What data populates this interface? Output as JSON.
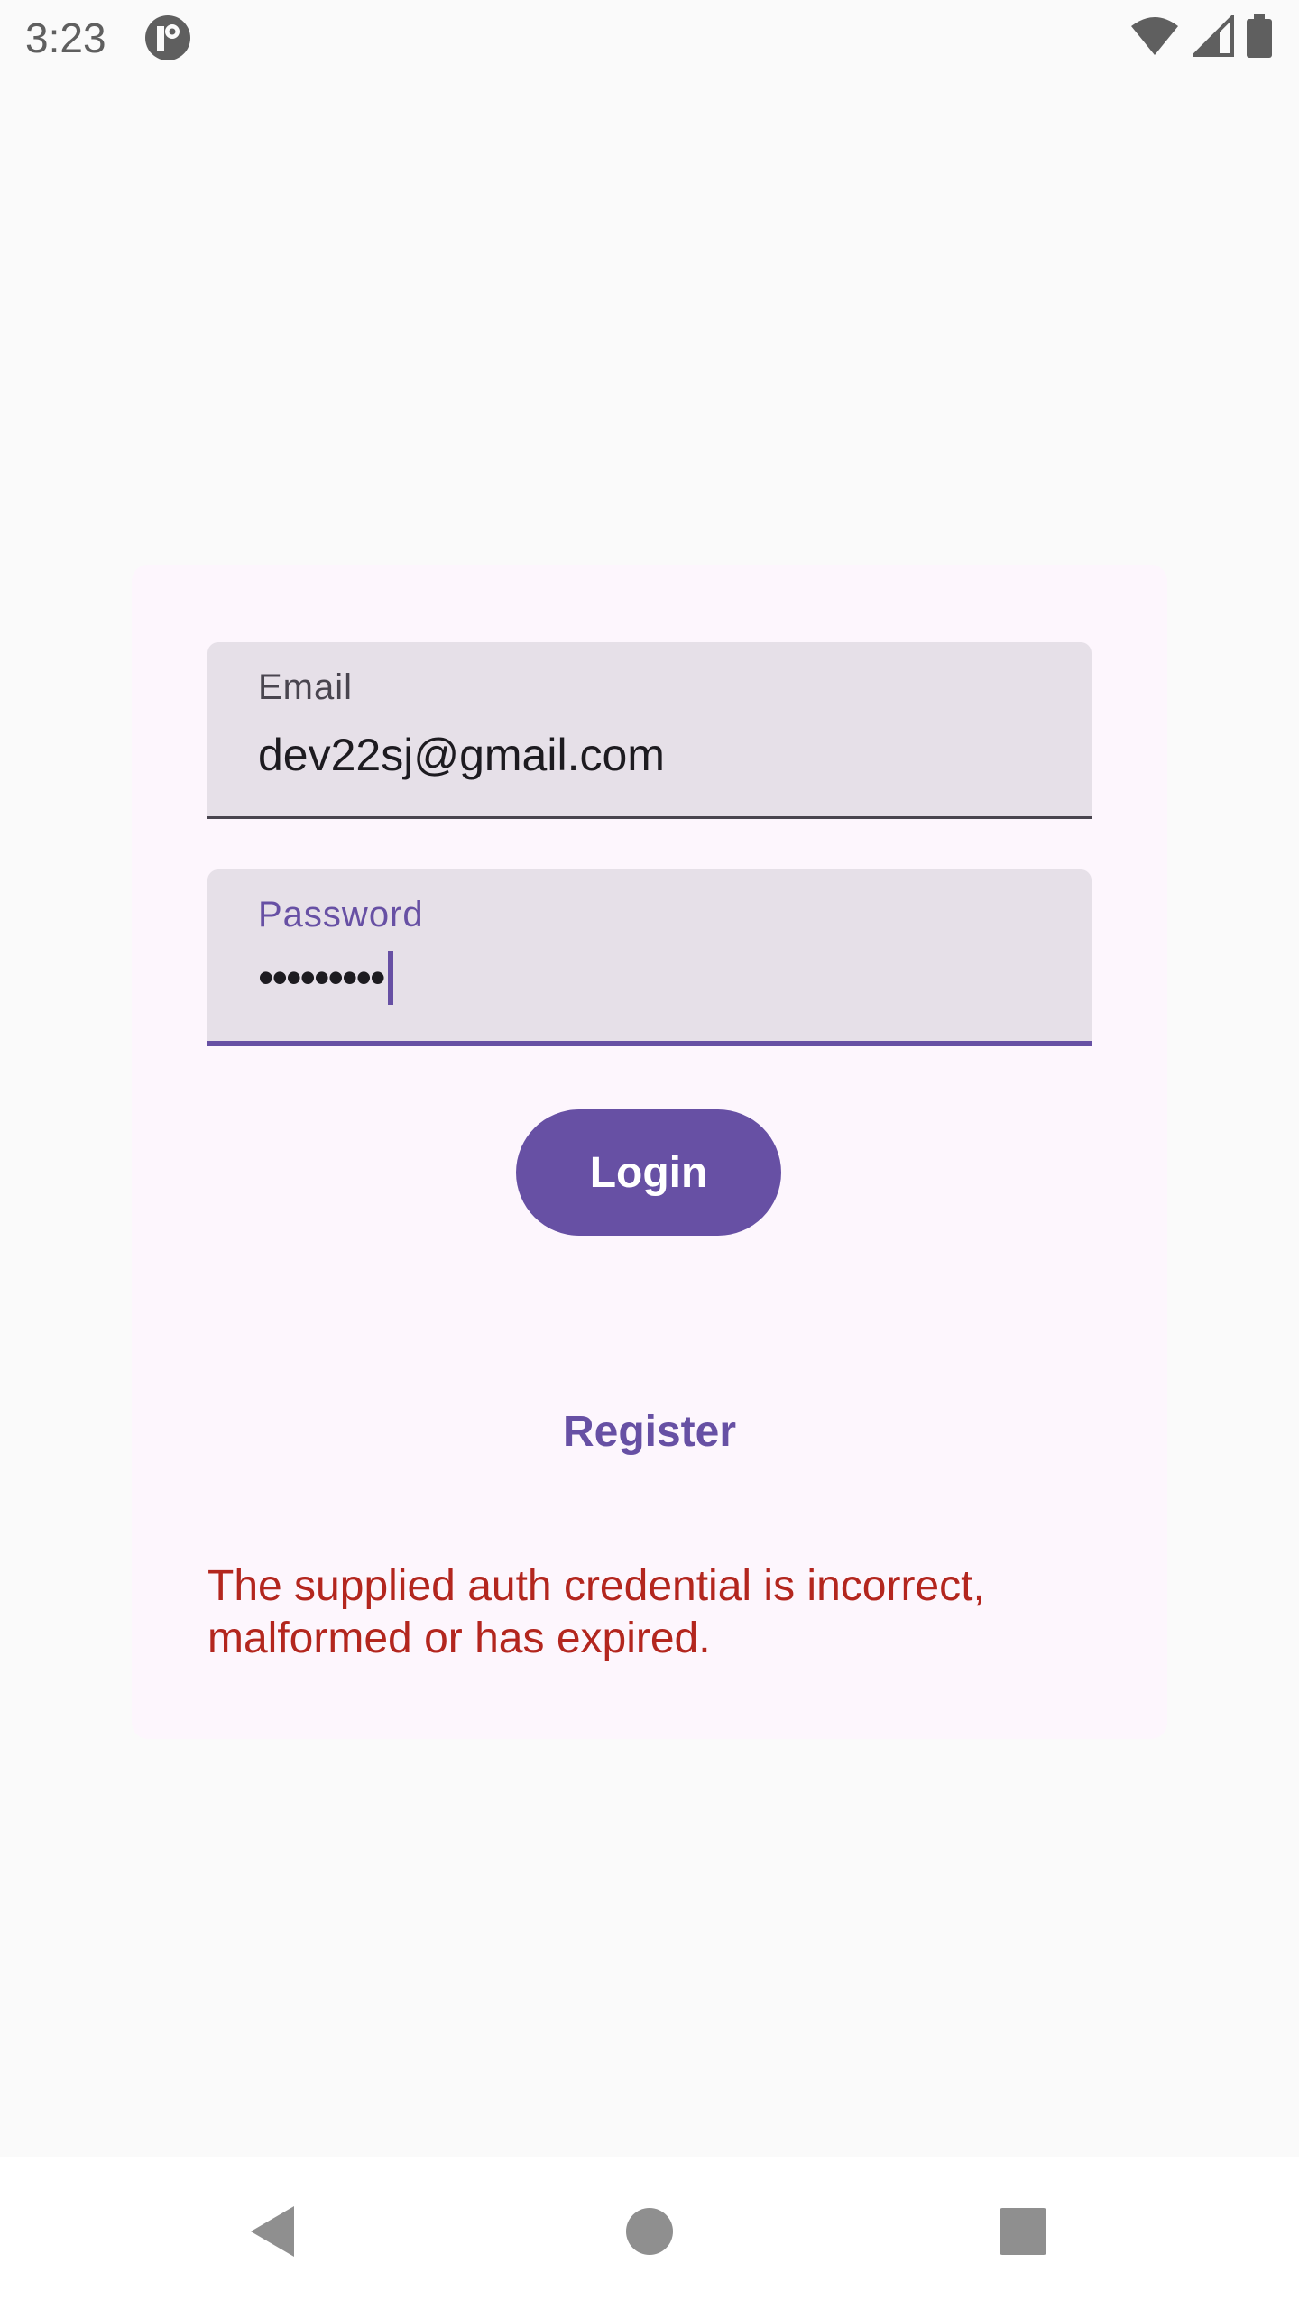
{
  "status_bar": {
    "time": "3:23",
    "icons": [
      "app-notification-icon",
      "wifi-icon",
      "cell-signal-icon",
      "battery-icon"
    ]
  },
  "login_form": {
    "email": {
      "label": "Email",
      "value": "dev22sj@gmail.com"
    },
    "password": {
      "label": "Password",
      "value": "•••••••••"
    },
    "login_label": "Login",
    "register_label": "Register",
    "error_message": "The supplied auth credential is incorrect, malformed or has expired."
  },
  "nav_bar": {
    "icons": [
      "back-icon",
      "home-icon",
      "recents-icon"
    ]
  },
  "colors": {
    "primary": "#6750a4",
    "error": "#b3261e",
    "field_bg": "#e6e0e8",
    "card_bg": "#fdf6fd"
  }
}
